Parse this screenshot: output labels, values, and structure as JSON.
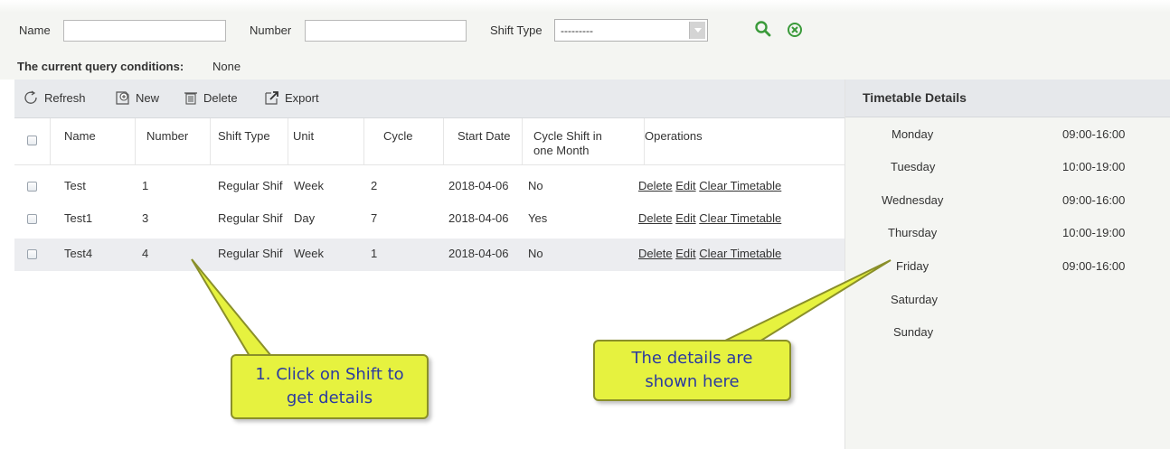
{
  "filter": {
    "name_label": "Name",
    "name_value": "",
    "number_label": "Number",
    "number_value": "",
    "shift_type_label": "Shift Type",
    "shift_type_value": "---------",
    "search_icon": "search-icon",
    "clear_icon": "clear-icon"
  },
  "query": {
    "label": "The current query conditions:",
    "value": "None"
  },
  "toolbar": {
    "refresh_label": "Refresh",
    "new_label": "New",
    "delete_label": "Delete",
    "export_label": "Export"
  },
  "table": {
    "columns": [
      "Name",
      "Number",
      "Shift Type",
      "Unit",
      "Cycle",
      "Start Date",
      "Cycle Shift in one Month",
      "Operations"
    ],
    "cycle_shift_col_line1": "Cycle Shift in",
    "cycle_shift_col_line2": "one Month",
    "rows": [
      {
        "name": "Test",
        "number": "1",
        "shift_type": "Regular Shif",
        "unit": "Week",
        "cycle": "2",
        "start_date": "2018-04-06",
        "cycle_shift": "No",
        "op_delete": "Delete",
        "op_edit": "Edit",
        "op_clear": "Clear Timetable"
      },
      {
        "name": "Test1",
        "number": "3",
        "shift_type": "Regular Shif",
        "unit": "Day",
        "cycle": "7",
        "start_date": "2018-04-06",
        "cycle_shift": "Yes",
        "op_delete": "Delete",
        "op_edit": "Edit",
        "op_clear": "Clear Timetable"
      },
      {
        "name": "Test4",
        "number": "4",
        "shift_type": "Regular Shif",
        "unit": "Week",
        "cycle": "1",
        "start_date": "2018-04-06",
        "cycle_shift": "No",
        "op_delete": "Delete",
        "op_edit": "Edit",
        "op_clear": "Clear Timetable"
      }
    ],
    "selected_row": 2
  },
  "timetable": {
    "title": "Timetable Details",
    "days": [
      {
        "day": "Monday",
        "time": "09:00-16:00"
      },
      {
        "day": "Tuesday",
        "time": "10:00-19:00"
      },
      {
        "day": "Wednesday",
        "time": "09:00-16:00"
      },
      {
        "day": "Thursday",
        "time": "10:00-19:00"
      },
      {
        "day": "Friday",
        "time": "09:00-16:00"
      },
      {
        "day": "Saturday",
        "time": ""
      },
      {
        "day": "Sunday",
        "time": ""
      }
    ]
  },
  "callouts": {
    "left_line1": "1. Click on Shift to",
    "left_line2": "get details",
    "right_line1": "The details are",
    "right_line2": "shown here"
  },
  "colors": {
    "callout_fill": "#e6f23f",
    "callout_text": "#2b3aa0",
    "search_icon": "#3a9a3a",
    "panel_bg": "#f4f5f2"
  }
}
